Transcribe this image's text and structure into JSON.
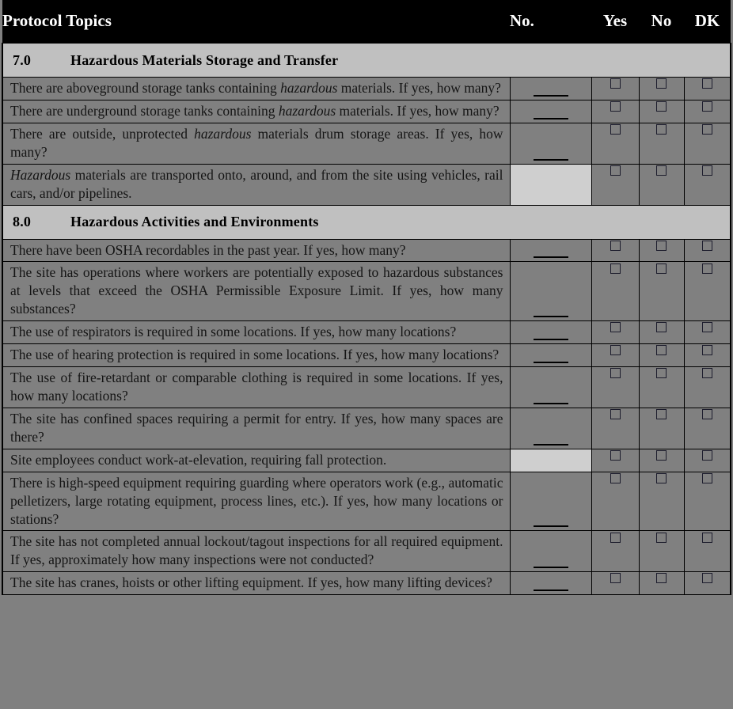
{
  "table": {
    "columns": [
      {
        "key": "topic",
        "label": "Protocol Topics"
      },
      {
        "key": "no",
        "label": "No."
      },
      {
        "key": "yes",
        "label": "Yes"
      },
      {
        "key": "nono",
        "label": "No"
      },
      {
        "key": "dk",
        "label": "DK"
      }
    ],
    "checkbox_glyph": "checkbox-empty",
    "blank_line_mark": "____",
    "colors": {
      "header_background": "#000000",
      "header_text": "#ffffff",
      "section_background": "#c0c0c0",
      "row_background": "#808080",
      "shaded_cell_background": "#cfcfcf",
      "border": "#000000"
    },
    "sections": [
      {
        "number": "7.0",
        "title": "Hazardous Materials Storage and Transfer",
        "rows": [
          {
            "text_parts": [
              {
                "text": "There are aboveground storage tanks containing ",
                "italic": false
              },
              {
                "text": "hazardous",
                "italic": true
              },
              {
                "text": " materials.  If yes, how many?",
                "italic": false
              }
            ],
            "no_shaded": false,
            "has_blank_line": true
          },
          {
            "text_parts": [
              {
                "text": "There are underground storage tanks containing ",
                "italic": false
              },
              {
                "text": "hazardous",
                "italic": true
              },
              {
                "text": " materials.  If yes, how many?",
                "italic": false
              }
            ],
            "no_shaded": false,
            "has_blank_line": true
          },
          {
            "text_parts": [
              {
                "text": "There are outside, unprotected ",
                "italic": false
              },
              {
                "text": "hazardous",
                "italic": true
              },
              {
                "text": " materials drum storage areas.  If yes, how many?",
                "italic": false
              }
            ],
            "no_shaded": false,
            "has_blank_line": true
          },
          {
            "text_parts": [
              {
                "text": "Hazardous",
                "italic": true
              },
              {
                "text": " materials are transported onto, around, and from the site using vehicles, rail cars, and/or pipelines.",
                "italic": false
              }
            ],
            "no_shaded": true,
            "has_blank_line": false
          }
        ]
      },
      {
        "number": "8.0",
        "title": "Hazardous Activities and Environments",
        "rows": [
          {
            "text_parts": [
              {
                "text": "There have been OSHA recordables in the past year.  If yes, how many?",
                "italic": false
              }
            ],
            "no_shaded": false,
            "has_blank_line": true
          },
          {
            "text_parts": [
              {
                "text": "The site has operations where workers are potentially exposed to hazardous substances at levels that exceed the OSHA Permissible Exposure Limit. If yes, how many substances?",
                "italic": false
              }
            ],
            "no_shaded": false,
            "has_blank_line": true
          },
          {
            "text_parts": [
              {
                "text": "The use of respirators is required in some locations.  If yes, how many locations?",
                "italic": false
              }
            ],
            "no_shaded": false,
            "has_blank_line": true
          },
          {
            "text_parts": [
              {
                "text": "The use of hearing protection is required in some locations.  If yes, how many locations?",
                "italic": false
              }
            ],
            "no_shaded": false,
            "has_blank_line": true
          },
          {
            "text_parts": [
              {
                "text": "The use of fire-retardant or comparable clothing is required in some locations.  If yes, how many locations?",
                "italic": false
              }
            ],
            "no_shaded": false,
            "has_blank_line": true
          },
          {
            "text_parts": [
              {
                "text": "The site has confined spaces requiring a permit for entry.  If yes, how many spaces are there?",
                "italic": false
              }
            ],
            "no_shaded": false,
            "has_blank_line": true
          },
          {
            "text_parts": [
              {
                "text": "Site employees conduct work-at-elevation, requiring fall protection.",
                "italic": false
              }
            ],
            "no_shaded": true,
            "has_blank_line": false
          },
          {
            "text_parts": [
              {
                "text": "There is high-speed equipment requiring guarding where operators work (e.g., automatic pelletizers, large rotating equipment, process lines, etc.). If yes, how many locations or stations?",
                "italic": false
              }
            ],
            "no_shaded": false,
            "has_blank_line": true
          },
          {
            "text_parts": [
              {
                "text": "The site has not completed annual lockout/tagout inspections for all required equipment. If yes, approximately how many inspections were not conducted?",
                "italic": false
              }
            ],
            "no_shaded": false,
            "has_blank_line": true
          },
          {
            "text_parts": [
              {
                "text": "The site has cranes, hoists or other lifting equipment. If yes, how many lifting devices?",
                "italic": false
              }
            ],
            "no_shaded": false,
            "has_blank_line": true
          }
        ]
      }
    ]
  }
}
